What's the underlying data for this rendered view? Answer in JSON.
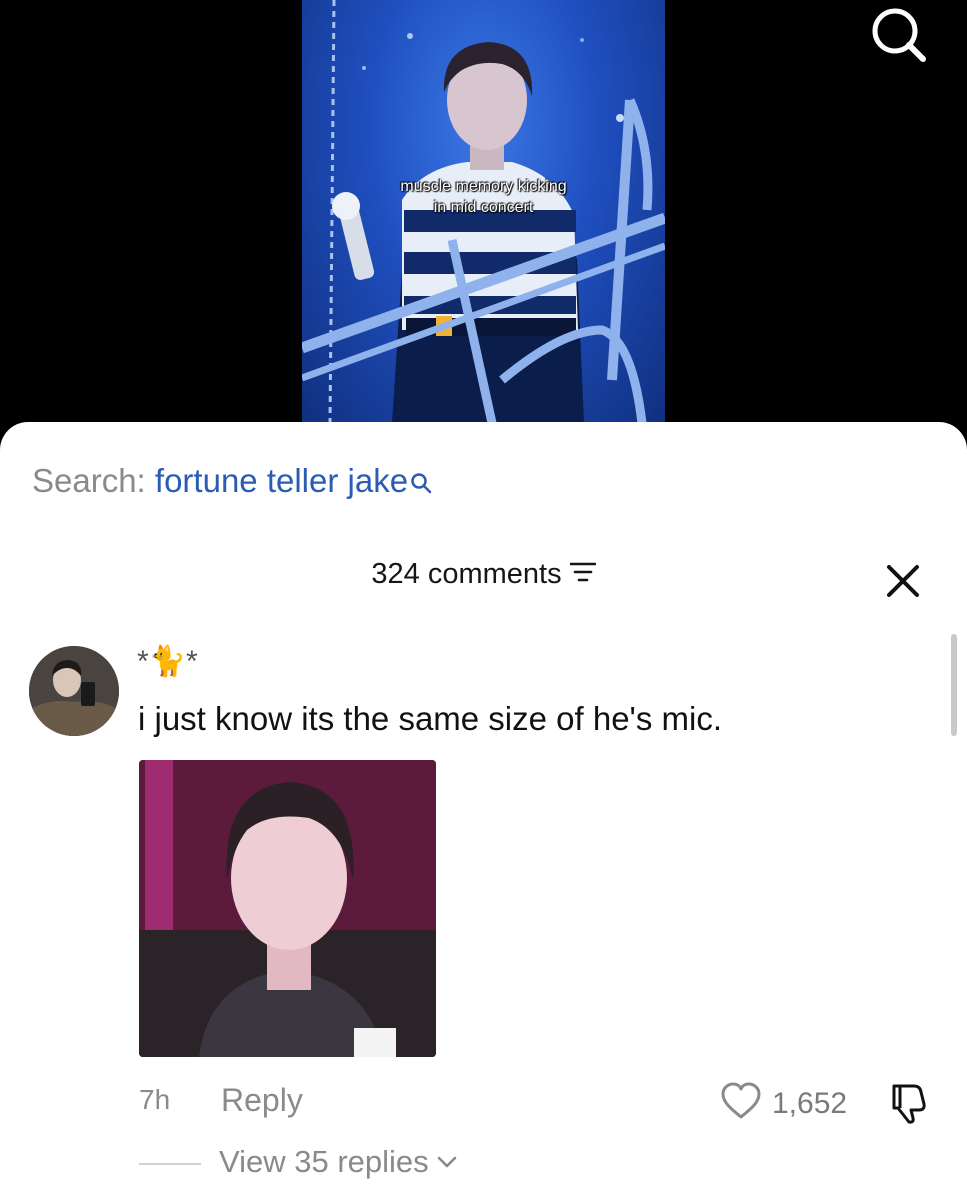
{
  "video": {
    "caption_line1": "muscle memory kicking",
    "caption_line2": "in mid concert"
  },
  "search": {
    "prefix": "Search: ",
    "query": "fortune teller jake"
  },
  "comments": {
    "count_label": "324 comments"
  },
  "comment": {
    "username": "*🐈*",
    "text": "i just know its the same size of he's mic.",
    "timestamp": "7h",
    "reply_label": "Reply",
    "like_count": "1,652",
    "view_replies_label": "View 35 replies"
  },
  "icons": {
    "top_search": "search-icon",
    "filter": "filter-icon",
    "close": "close-icon",
    "like": "heart-icon",
    "dislike": "thumbs-down-icon",
    "chevron": "chevron-down-icon"
  },
  "colors": {
    "search_query": "#2a5cb5",
    "muted_text": "#8a8a8a"
  }
}
